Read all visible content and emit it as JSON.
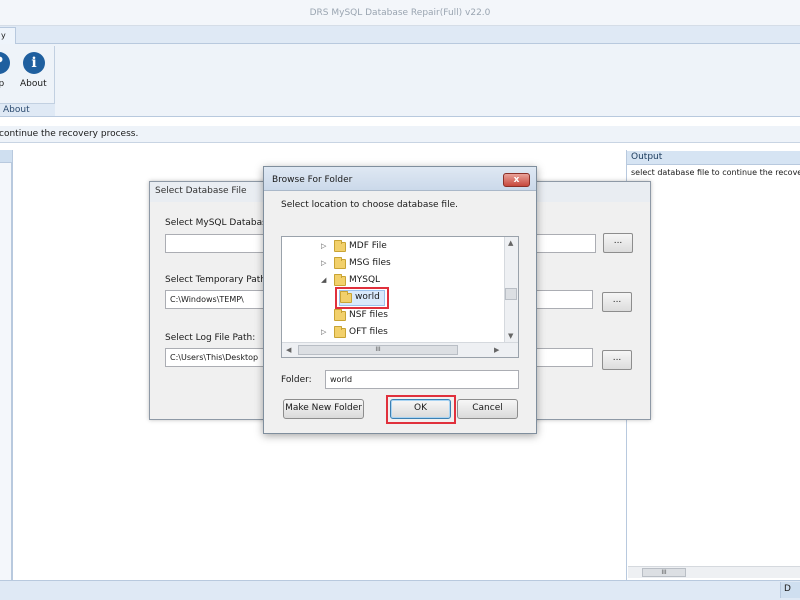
{
  "app": {
    "title": "DRS MySQL Database Repair(Full) v22.0",
    "ribbon_tab_label": "y",
    "help_label": "lp",
    "about_label": "About",
    "group_label": "About",
    "status_text": "continue the recovery process.",
    "bottom_right_label": "D"
  },
  "output": {
    "header": "Output",
    "text": "select database file to continue the recover",
    "scroll_thumb": "III"
  },
  "db_dialog": {
    "title": "Select Database File",
    "mysql_label": "Select MySQL Database f",
    "mysql_value": "",
    "temp_label": "Select Temporary Path:",
    "temp_value": "C:\\Windows\\TEMP\\",
    "log_label": "Select Log File Path:",
    "log_value": "C:\\Users\\This\\Desktop",
    "browse_label": "..."
  },
  "browse_dialog": {
    "title": "Browse For Folder",
    "close_label": "x",
    "instructions": "Select location to choose database file.",
    "tree_items": [
      {
        "label": "MDF File",
        "expander": "▷"
      },
      {
        "label": "MSG files",
        "expander": "▷"
      },
      {
        "label": "MYSQL",
        "expander": "◢"
      },
      {
        "label": "world",
        "expander": ""
      },
      {
        "label": "NSF files",
        "expander": ""
      },
      {
        "label": "OFT files",
        "expander": "▷"
      }
    ],
    "hscroll_thumb": "III",
    "folder_label": "Folder:",
    "folder_value": "world",
    "make_new_folder_label": "Make New Folder",
    "ok_label": "OK",
    "cancel_label": "Cancel"
  },
  "colors": {
    "highlight": "#e0303c",
    "selection": "#d9e9fb",
    "ribbon": "#dfe9f5"
  }
}
